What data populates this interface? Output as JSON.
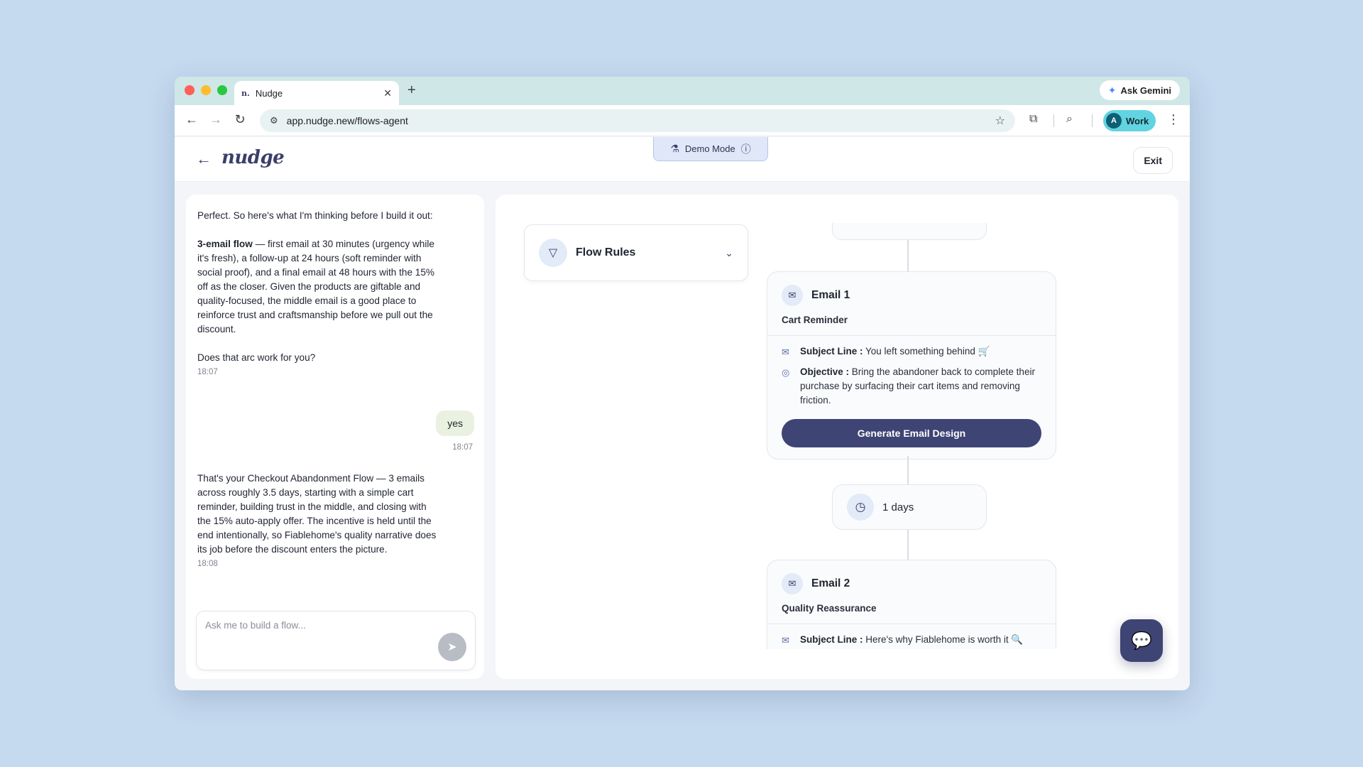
{
  "browser": {
    "tab_title": "Nudge",
    "tab_favicon": "n.",
    "url": "app.nudge.new/flows-agent",
    "gemini_label": "Ask Gemini",
    "profile_initial": "A",
    "profile_label": "Work"
  },
  "header": {
    "logo": "nudge",
    "demo_mode": "Demo Mode",
    "exit_label": "Exit"
  },
  "chat": {
    "ai_message_1": {
      "intro": "Perfect. So here's what I'm thinking before I build it out:",
      "flow_bold": "3-email flow",
      "flow_text": " — first email at 30 minutes (urgency while it's fresh), a follow-up at 24 hours (soft reminder with social proof), and a final email at 48 hours with the 15% off as the closer. Given the products are giftable and quality-focused, the middle email is a good place to reinforce trust and craftsmanship before we pull out the discount.",
      "question": "Does that arc work for you?",
      "time": "18:07"
    },
    "user_message": {
      "text": "yes",
      "time": "18:07"
    },
    "ai_message_2": {
      "text": "That's your Checkout Abandonment Flow — 3 emails across roughly 3.5 days, starting with a simple cart reminder, building trust in the middle, and closing with the 15% auto-apply offer. The incentive is held until the end intentionally, so Fiablehome's quality narrative does its job before the discount enters the picture.",
      "time": "18:08"
    },
    "input_placeholder": "Ask me to build a flow..."
  },
  "canvas": {
    "flow_rules_label": "Flow Rules",
    "emails": [
      {
        "title": "Email 1",
        "subtitle": "Cart Reminder",
        "subject_key": "Subject Line :",
        "subject_value": " You left something behind 🛒",
        "objective_key": "Objective :",
        "objective_value": " Bring the abandoner back to complete their purchase by surfacing their cart items and removing friction.",
        "button_label": "Generate Email Design"
      },
      {
        "title": "Email 2",
        "subtitle": "Quality Reassurance",
        "subject_key": "Subject Line :",
        "subject_value": " Here's why Fiablehome is worth it 🔍"
      }
    ],
    "delay_label": "1 days"
  },
  "icons": {
    "back": "arrow-left",
    "flow_rules": "filter-funnel",
    "mail": "envelope",
    "objective": "target",
    "delay": "clock",
    "send": "paper-plane",
    "support": "chat-bubble-sparkle"
  }
}
